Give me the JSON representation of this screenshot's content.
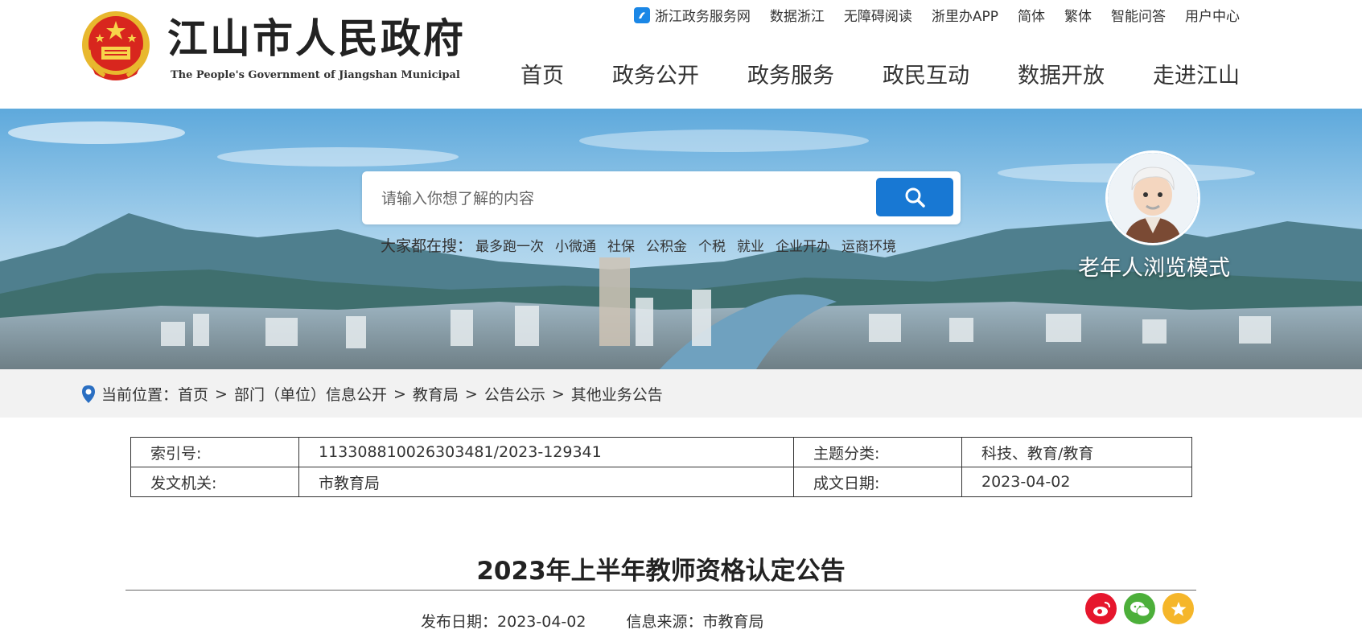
{
  "header": {
    "title": "江山市人民政府",
    "subtitle": "The People's Government of Jiangshan Municipal",
    "top_links": [
      "浙江政务服务网",
      "数据浙江",
      "无障碍阅读",
      "浙里办APP",
      "简体",
      "繁体",
      "智能问答",
      "用户中心"
    ],
    "nav": [
      "首页",
      "政务公开",
      "政务服务",
      "政民互动",
      "数据开放",
      "走进江山"
    ]
  },
  "banner": {
    "search_placeholder": "请输入你想了解的内容",
    "hot_label": "大家都在搜：",
    "hot_terms": [
      "最多跑一次",
      "小微通",
      "社保",
      "公积金",
      "个税",
      "就业",
      "企业开办",
      "运商环境"
    ],
    "elder_mode": "老年人浏览模式"
  },
  "breadcrumb": {
    "label": "当前位置：",
    "items": [
      "首页",
      "部门（单位）信息公开",
      "教育局",
      "公告公示",
      "其他业务公告"
    ],
    "separator": ">"
  },
  "meta": {
    "index_label": "索引号:",
    "index_value": "113308810026303481/2023-129341",
    "topic_label": "主题分类:",
    "topic_value": "科技、教育/教育",
    "issuer_label": "发文机关:",
    "issuer_value": "市教育局",
    "date_label": "成文日期:",
    "date_value": "2023-04-02"
  },
  "article": {
    "title": "2023年上半年教师资格认定公告",
    "publish_label": "发布日期：",
    "publish_date": "2023-04-02",
    "source_label": "信息来源：",
    "source_value": "市教育局"
  },
  "share": {
    "icons": [
      "weibo-icon",
      "wechat-icon",
      "favorite-icon"
    ],
    "colors": [
      "#e6162d",
      "#4caf3a",
      "#f5b62a"
    ]
  },
  "colors": {
    "accent": "#1878d3",
    "crumb_bg": "#f2f2f2"
  }
}
